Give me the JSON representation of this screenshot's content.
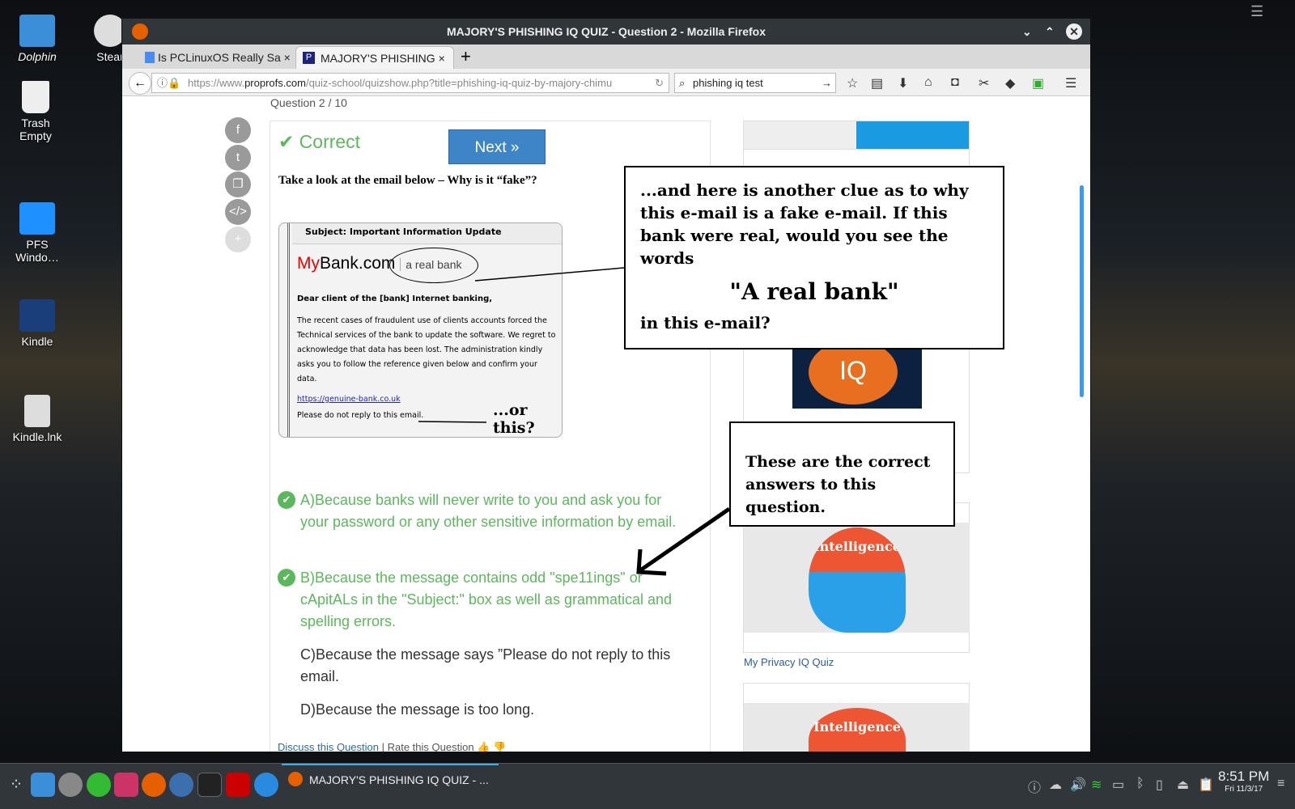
{
  "desktop": {
    "icons": [
      {
        "label": "Dolphin"
      },
      {
        "label": "Stear"
      },
      {
        "label": "Trash\nEmpty"
      },
      {
        "label": "PFS\nWindo…"
      },
      {
        "label": "Kindle"
      },
      {
        "label": "Kindle.lnk"
      }
    ]
  },
  "window": {
    "title": "MAJORY'S PHISHING IQ QUIZ - Question 2 - Mozilla Firefox"
  },
  "tabs": [
    {
      "label": "Is PCLinuxOS Really Sa"
    },
    {
      "label": "MAJORY'S PHISHING"
    }
  ],
  "nav": {
    "url_prefix": "https://www.",
    "url_domain": "proprofs.com",
    "url_rest": "/quiz-school/quizshow.php?title=phishing-iq-quiz-by-majory-chimu",
    "search_value": "phishing iq test"
  },
  "quiz": {
    "progress": "Question 2 / 10",
    "status": "Correct",
    "next_label": "Next »",
    "question": "Take a look at the email below – Why is it “fake”?",
    "email": {
      "subject_label": "Subject:",
      "subject": "Important Information Update",
      "brand_my": "My",
      "brand_rest": "Bank.com",
      "tagline": "a real bank",
      "greeting": "Dear client of the [bank] Internet banking,",
      "body": "The recent cases of fraudulent use of clients accounts forced the Technical services of the bank to update the software. We regret to acknowledge that data has been lost. The administration kindly asks you to follow the reference given below and confirm your data.",
      "link": "https://genuine-bank.co.uk",
      "footer": "Please do not reply to this email.",
      "annotation": "...or this?"
    },
    "answers": [
      {
        "text": "A)Because banks will never write to you and ask you for your password or any other sensitive information by email.",
        "correct": true
      },
      {
        "text": "B)Because the message contains odd \"spe11ings\" or cApitALs in the \"Subject:\" box as well as grammatical and spelling errors.",
        "correct": true
      },
      {
        "text": "C)Because the message says ”Please do not reply to this email.",
        "correct": false
      },
      {
        "text": "D)Because the message is too long.",
        "correct": false
      }
    ],
    "discuss_link": "Discuss this Question",
    "rate_label": "| Rate this Question"
  },
  "sidebar": {
    "iq_label": "IQ",
    "ad_caption": "My Privacy IQ Quiz",
    "intelligence_label": "Intelligence"
  },
  "notes": {
    "clue": "...and here is another clue as to why this e-mail is a fake e-mail.  If this bank were real, would you see the words",
    "quote": "\"A real bank\"",
    "clue_end": "in this e-mail?",
    "correct": "These are the correct answers to this question."
  },
  "taskbar": {
    "active_window": "MAJORY'S PHISHING IQ QUIZ - ...",
    "time": "8:51 PM",
    "date": "Fri 11/3/17"
  },
  "colors": {
    "accent": "#3d85c6",
    "correct": "#5cb85c",
    "taskbar": "#31363b"
  }
}
